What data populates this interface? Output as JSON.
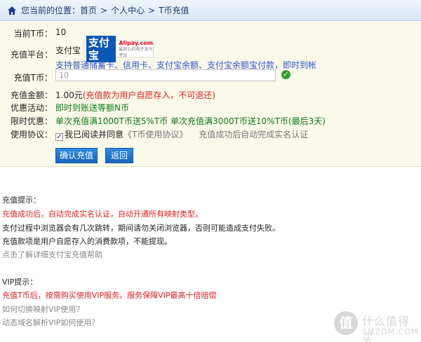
{
  "breadcrumb": {
    "prefix": "您当前的位置：",
    "items": [
      "首页",
      "个人中心",
      "T币充值"
    ],
    "separator": ">"
  },
  "form": {
    "balance_label": "当前T币：",
    "balance_value": "10",
    "platform_label": "充值平台：",
    "platform_name": "支付宝",
    "alipay_logo_cn": "支付宝",
    "alipay_logo_en": "Alipay.com",
    "alipay_logo_sub": "最放心的电子支付平台",
    "payment_methods": "支持普通储蓄卡、信用卡、支付宝余额、支付宝余额宝付款，即时到帐",
    "amount_label": "充值T币：",
    "amount_value": "10",
    "money_label": "充值金额：",
    "money_value": "1.00元",
    "money_note": "(充值款为用户自愿存入，不可退还)",
    "promo_label": "优惠活动：",
    "promo_value": "即时到账送等额N币",
    "limited_label": "限时优惠：",
    "limited_value": "单次充值满1000T币送5%T币 单次充值满3000T币送10%T币(最后3天)",
    "agreement_label": "使用协议：",
    "agreement_checked": true,
    "agreement_text": "我已阅读并同意",
    "agreement_link": "《T币使用协议》",
    "agreement_note": "充值成功后自动完成实名认证",
    "confirm_button": "确认充值",
    "back_button": "返回"
  },
  "tips": {
    "recharge_title": "充值提示：",
    "recharge_line1": "充值成功后，自动完成实名认证，自动开通所有映射类型。",
    "recharge_line2": "支付过程中浏览器会有几次跳转，期间请勿关闭浏览器，否则可能造成支付失败。",
    "recharge_line3": "充值款项是用户自愿存入的消费款项，不能提现。",
    "recharge_help_link": "点击了解详细支付宝充值帮助",
    "vip_title": "VIP提示：",
    "vip_line1": "充值T币后，按需购买使用VIP服务。服务保障VIP最高十倍赔偿",
    "vip_link1": "如何切换映射VIP使用？",
    "vip_link2": "动态域名解析VIP如何使用？"
  },
  "watermark": {
    "badge": "值",
    "text": "什么值得买",
    "domain": "SMZDM.COM"
  },
  "colors": {
    "panel_bg": "#fbf9ea",
    "link_blue": "#3355cc",
    "warning_red": "#e02020",
    "promo_green": "#0a7a1a",
    "button_blue": "#1f78cf"
  }
}
